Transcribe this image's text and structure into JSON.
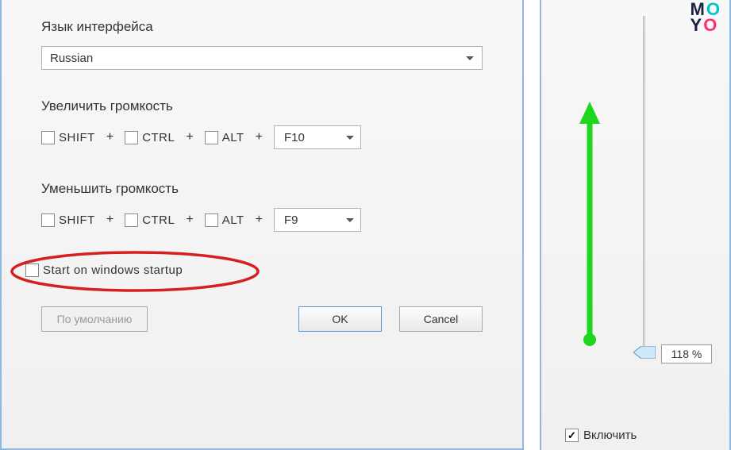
{
  "left": {
    "language_label": "Язык интерфейса",
    "language_value": "Russian",
    "increase_label": "Увеличить громкость",
    "decrease_label": "Уменьшить громкость",
    "shift": "SHIFT",
    "ctrl": "CTRL",
    "alt": "ALT",
    "increase_key": "F10",
    "decrease_key": "F9",
    "startup_label": "Start on windows startup",
    "default_btn": "По умолчанию",
    "ok_btn": "OK",
    "cancel_btn": "Cancel"
  },
  "right": {
    "percent": "118 %",
    "enable_label": "Включить"
  },
  "logo": {
    "m": "M",
    "o1": "O",
    "y": "Y",
    "o2": "O"
  }
}
